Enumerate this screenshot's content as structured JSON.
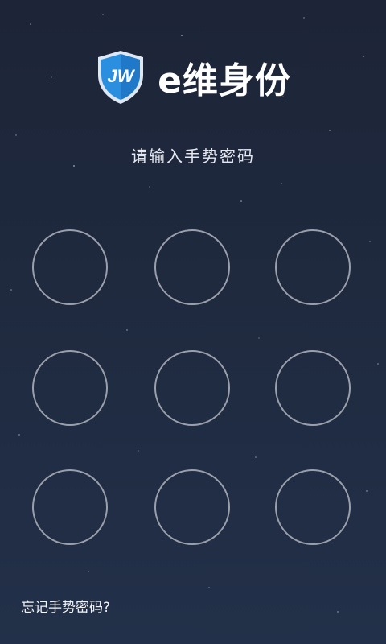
{
  "header": {
    "logo_text": "JW",
    "app_title": "e维身份"
  },
  "prompt": {
    "text": "请输入手势密码"
  },
  "pattern_lock": {
    "dot_count": 9,
    "dot_color": "#9aa0ab"
  },
  "footer": {
    "forgot_link": "忘记手势密码?"
  },
  "colors": {
    "background_top": "#1d2437",
    "background_bottom": "#223049",
    "logo_blue": "#2b8fe0"
  }
}
